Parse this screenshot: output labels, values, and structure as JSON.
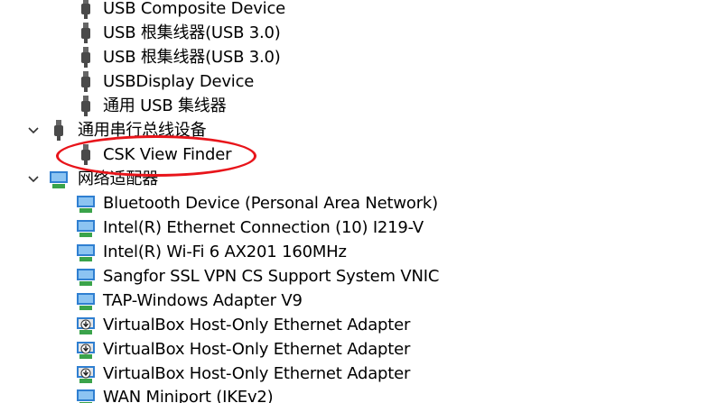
{
  "usb_devices": [
    {
      "label": "USB Composite Device",
      "icon": "usb-plug-icon"
    },
    {
      "label": "USB 根集线器(USB 3.0)",
      "icon": "usb-plug-icon"
    },
    {
      "label": "USB 根集线器(USB 3.0)",
      "icon": "usb-plug-icon"
    },
    {
      "label": "USBDisplay Device",
      "icon": "usb-plug-icon"
    },
    {
      "label": "通用 USB 集线器",
      "icon": "usb-plug-icon"
    }
  ],
  "serial_bus": {
    "label": "通用串行总线设备",
    "icon": "usb-plug-icon",
    "expanded": true,
    "children": [
      {
        "label": "CSK View Finder",
        "icon": "usb-plug-icon"
      }
    ]
  },
  "network": {
    "label": "网络适配器",
    "icon": "network-adapter-icon",
    "expanded": true,
    "children": [
      {
        "label": "Bluetooth Device (Personal Area Network)",
        "icon": "network-adapter-icon"
      },
      {
        "label": "Intel(R) Ethernet Connection (10) I219-V",
        "icon": "network-adapter-icon"
      },
      {
        "label": "Intel(R) Wi-Fi 6 AX201 160MHz",
        "icon": "network-adapter-icon"
      },
      {
        "label": "Sangfor SSL VPN CS Support System VNIC",
        "icon": "network-adapter-icon"
      },
      {
        "label": "TAP-Windows Adapter V9",
        "icon": "network-adapter-icon"
      },
      {
        "label": "VirtualBox Host-Only Ethernet Adapter",
        "icon": "network-adapter-download-icon"
      },
      {
        "label": "VirtualBox Host-Only Ethernet Adapter",
        "icon": "network-adapter-download-icon"
      },
      {
        "label": "VirtualBox Host-Only Ethernet Adapter",
        "icon": "network-adapter-download-icon"
      },
      {
        "label": "WAN Miniport (IKEv2)",
        "icon": "network-adapter-icon"
      }
    ]
  },
  "colors": {
    "highlight": "#e8141a",
    "monitor_blue": "#2f7fd1",
    "monitor_green": "#3aa34a",
    "usb_gray": "#555555"
  }
}
